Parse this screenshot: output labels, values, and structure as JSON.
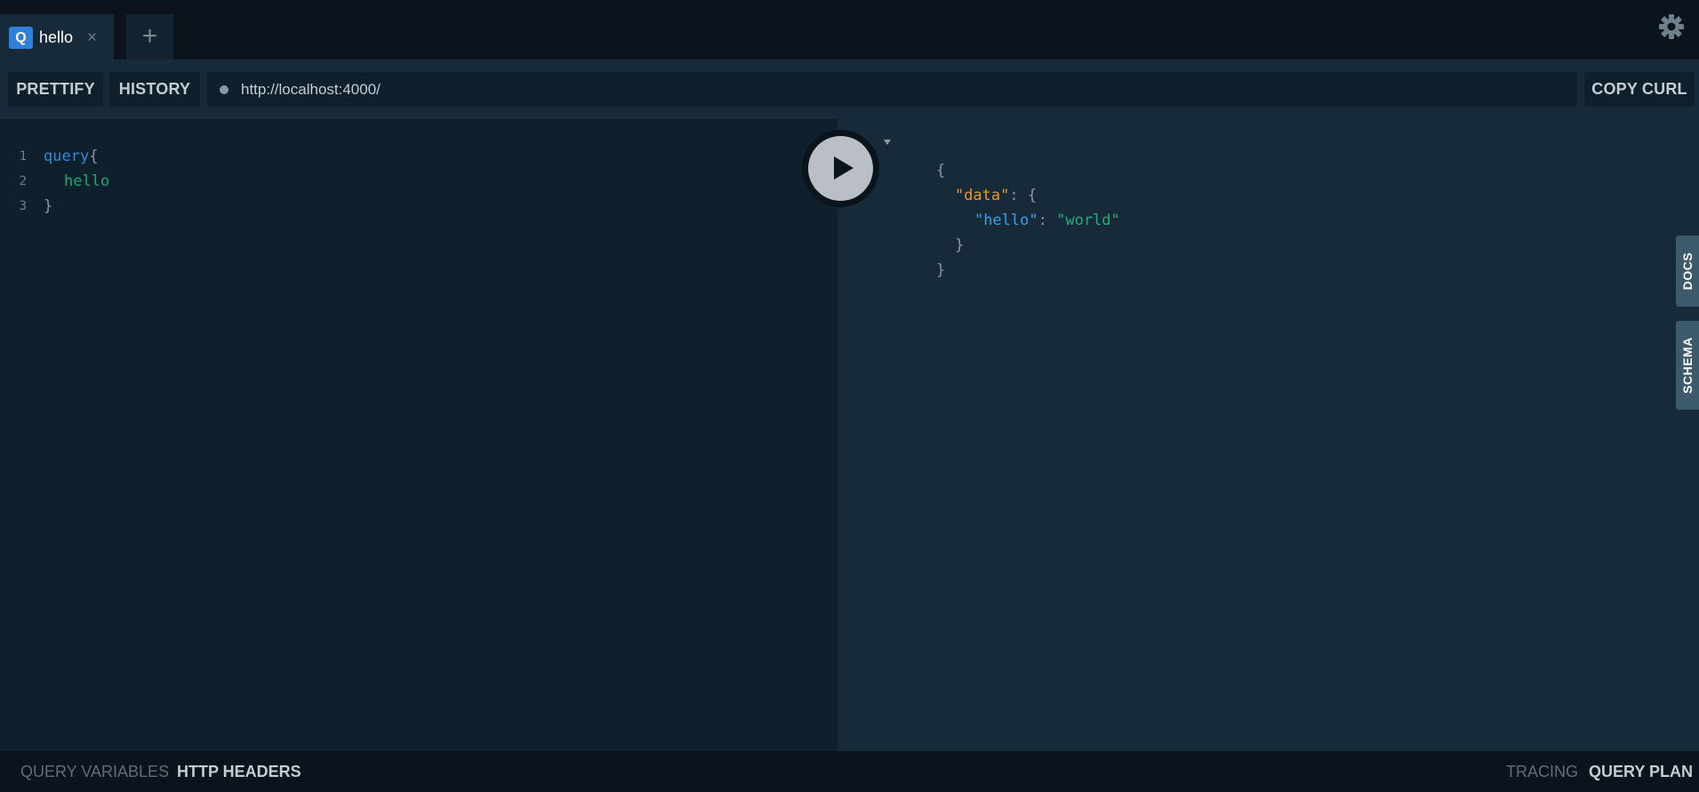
{
  "tabs": [
    {
      "badge": "Q",
      "title": "hello",
      "close": "×"
    }
  ],
  "tab_add": "+",
  "settings_icon": "gear-icon",
  "toolbar": {
    "prettify_label": "PRETTIFY",
    "history_label": "HISTORY",
    "endpoint": "http://localhost:4000/",
    "copy_curl_label": "COPY CURL"
  },
  "editor": {
    "lines": [
      {
        "num": "1",
        "keyword": "query",
        "punc": "{"
      },
      {
        "num": "2",
        "field": "hello"
      },
      {
        "num": "3",
        "punc": "}"
      }
    ]
  },
  "result": {
    "open_brace": "{",
    "data_key": "\"data\"",
    "colon": ":",
    "data_open": "{",
    "hello_key": "\"hello\"",
    "hello_value": "\"world\"",
    "data_close": "}",
    "close_brace": "}"
  },
  "side_tabs": {
    "docs": "DOCS",
    "schema": "SCHEMA"
  },
  "bottom": {
    "query_variables": "QUERY VARIABLES",
    "http_headers": "HTTP HEADERS",
    "tracing": "TRACING",
    "query_plan": "QUERY PLAN"
  },
  "colors": {
    "keyword": "#2e89d9",
    "field": "#1ea970",
    "json_key_orange": "#e99b27",
    "json_key_blue": "#3aa1e6",
    "json_string": "#1fb07a",
    "badge": "#2e80d8"
  }
}
